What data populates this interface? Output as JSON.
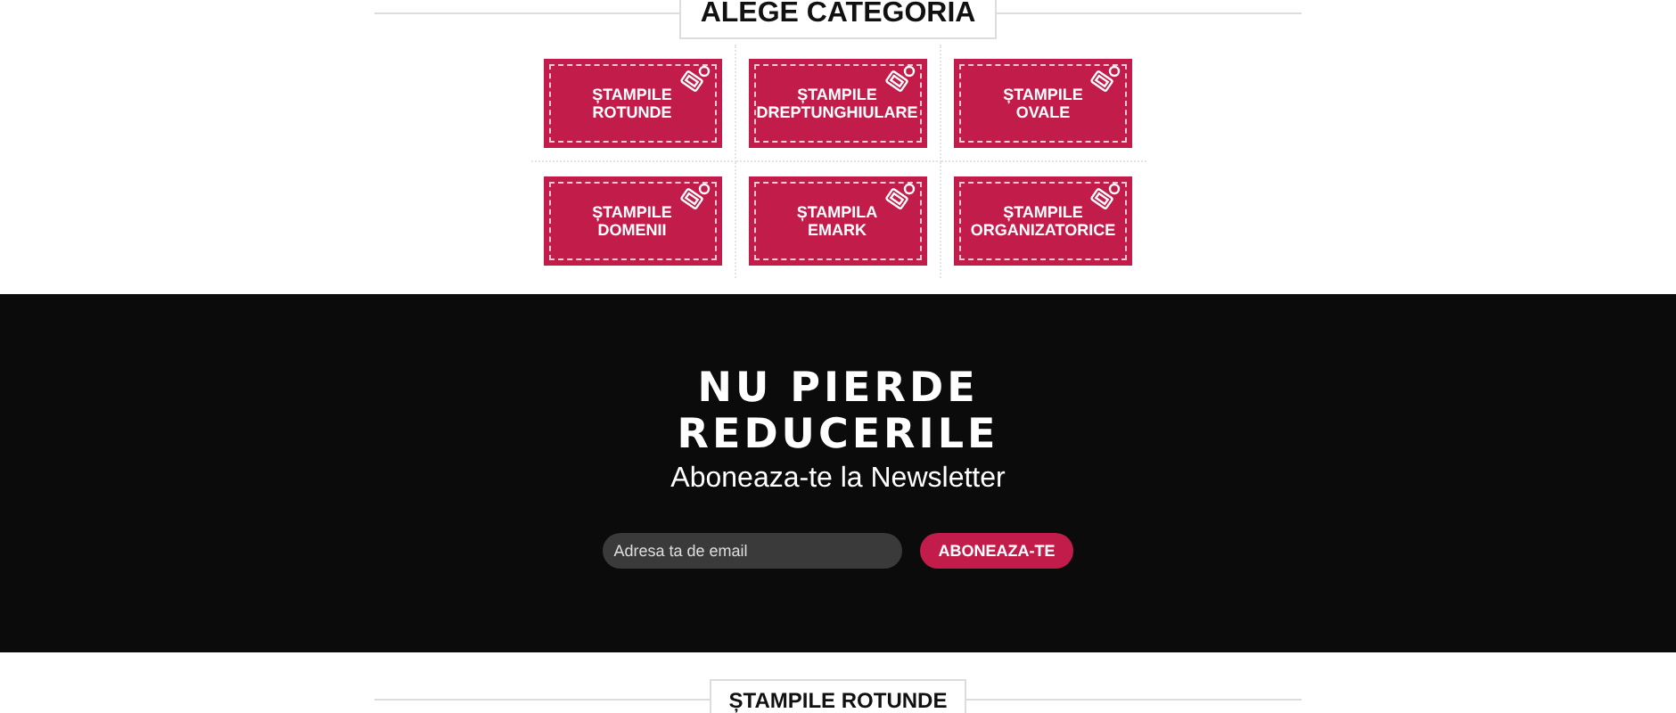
{
  "category_heading": "ALEGE CATEGORIA",
  "categories": [
    {
      "line1": "ȘTAMPILE",
      "line2": "ROTUNDE"
    },
    {
      "line1": "ȘTAMPILE",
      "line2": "DREPTUNGHIULARE"
    },
    {
      "line1": "ȘTAMPILE",
      "line2": "OVALE"
    },
    {
      "line1": "ȘTAMPILE",
      "line2": "DOMENII"
    },
    {
      "line1": "ȘTAMPILA",
      "line2": "EMARK"
    },
    {
      "line1": "ȘTAMPILE",
      "line2": "ORGANIZATORICE"
    }
  ],
  "newsletter": {
    "title_line1": "NU PIERDE",
    "title_line2": "REDUCERILE",
    "subtitle": "Aboneaza-te la Newsletter",
    "email": {
      "placeholder": "Adresa ta de email"
    },
    "button": "ABONEAZA-TE"
  },
  "section_heading": "ȘTAMPILE ROTUNDE"
}
